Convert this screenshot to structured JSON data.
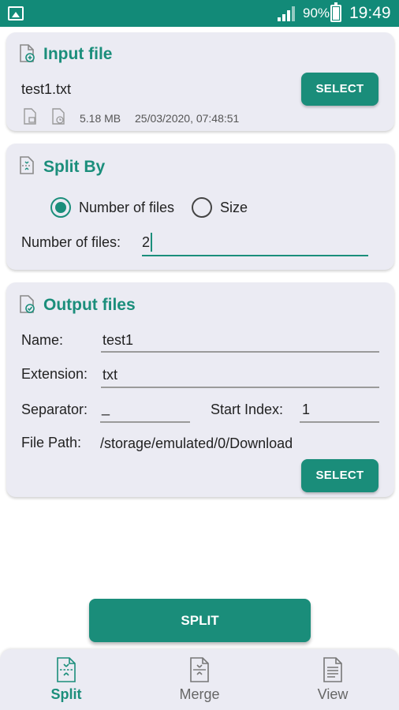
{
  "status_bar": {
    "battery": "90%",
    "time": "19:49"
  },
  "input_card": {
    "title": "Input file",
    "file_name": "test1.txt",
    "file_size": "5.18 MB",
    "file_date": "25/03/2020, 07:48:51",
    "select_label": "SELECT"
  },
  "split_card": {
    "title": "Split By",
    "option_number": "Number of files",
    "option_size": "Size",
    "selected_option": "Number of files",
    "number_label": "Number of files:",
    "number_value": "2"
  },
  "output_card": {
    "title": "Output files",
    "name_label": "Name:",
    "name_value": "test1",
    "extension_label": "Extension:",
    "extension_value": "txt",
    "separator_label": "Separator:",
    "separator_value": "_",
    "start_index_label": "Start Index:",
    "start_index_value": "1",
    "path_label": "File Path:",
    "path_value": "/storage/emulated/0/Download",
    "select_label": "SELECT"
  },
  "split_button": "SPLIT",
  "bottom_nav": [
    {
      "label": "Split",
      "icon": "split-icon",
      "active": true
    },
    {
      "label": "Merge",
      "icon": "merge-icon",
      "active": false
    },
    {
      "label": "View",
      "icon": "view-icon",
      "active": false
    }
  ],
  "colors": {
    "accent": "#1b8e7b",
    "status_bar": "#128a78",
    "card_bg": "#ebebf3"
  }
}
